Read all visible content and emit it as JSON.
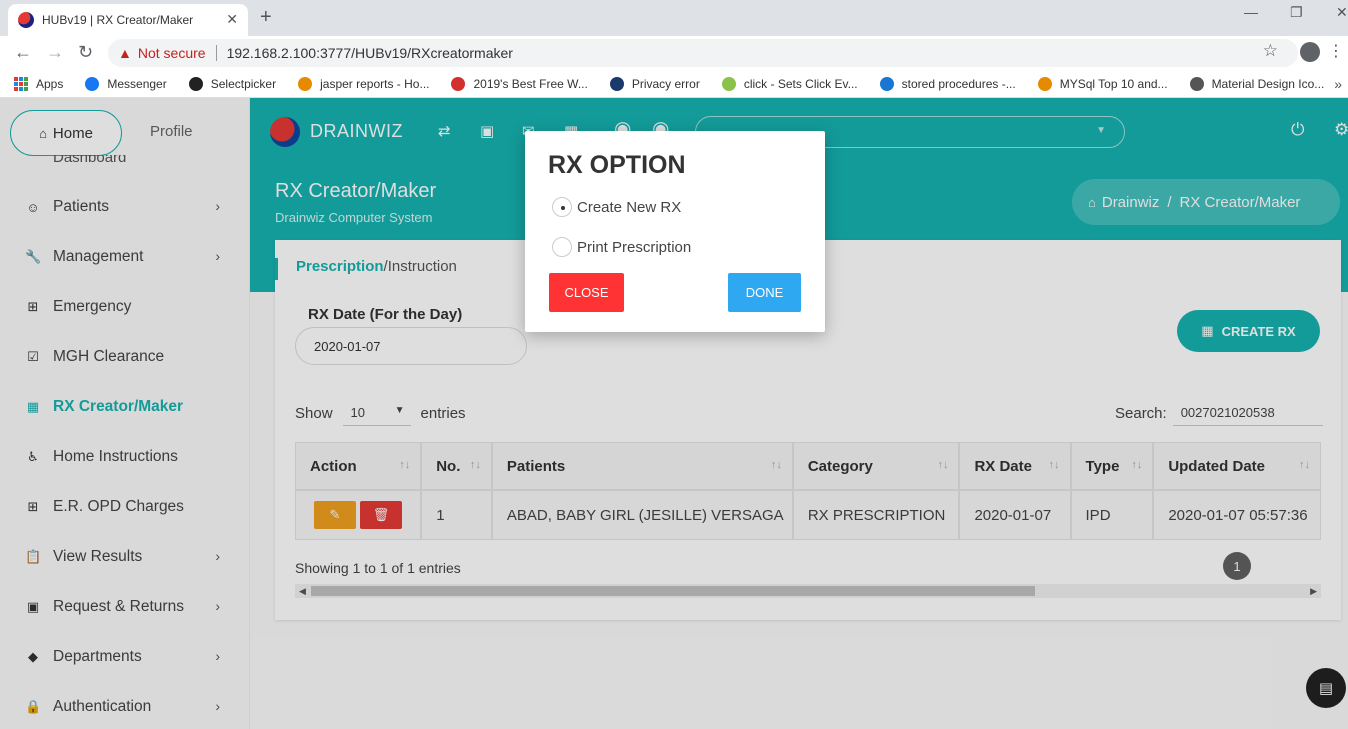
{
  "browser": {
    "tab_title": "HUBv19 | RX Creator/Maker",
    "tab_close": "✕",
    "new_tab": "+",
    "not_secure": "Not secure",
    "url": "192.168.2.100:3777/HUBv19/RXcreatormaker",
    "bookmarks": [
      "Apps",
      "Messenger",
      "Selectpicker",
      "jasper reports - Ho...",
      "2019's Best Free W...",
      "Privacy error",
      "click - Sets Click Ev...",
      "stored procedures -...",
      "MYSql Top 10 and...",
      "Material Design Ico..."
    ],
    "bookmarks_more": "»"
  },
  "sidebar": {
    "home": "Home",
    "profile": "Profile",
    "ghost": "Dashboard",
    "items": [
      {
        "label": "Patients",
        "icon": "smile-icon",
        "glyph": "☺",
        "chevron": "›"
      },
      {
        "label": "Management",
        "icon": "wrench-icon",
        "glyph": "🔧",
        "chevron": "›"
      },
      {
        "label": "Emergency",
        "icon": "plus-square-icon",
        "glyph": "⊞",
        "chevron": ""
      },
      {
        "label": "MGH Clearance",
        "icon": "check-square-icon",
        "glyph": "☑",
        "chevron": ""
      },
      {
        "label": "RX Creator/Maker",
        "icon": "grid-icon",
        "glyph": "▦",
        "chevron": ""
      },
      {
        "label": "Home Instructions",
        "icon": "wheelchair-icon",
        "glyph": "♿",
        "chevron": ""
      },
      {
        "label": "E.R. OPD Charges",
        "icon": "hospital-icon",
        "glyph": "⊞",
        "chevron": ""
      },
      {
        "label": "View Results",
        "icon": "clipboard-icon",
        "glyph": "📋",
        "chevron": "›"
      },
      {
        "label": "Request & Returns",
        "icon": "receipt-icon",
        "glyph": "▣",
        "chevron": "›"
      },
      {
        "label": "Departments",
        "icon": "tag-icon",
        "glyph": "◆",
        "chevron": "›"
      },
      {
        "label": "Authentication",
        "icon": "lock-icon",
        "glyph": "🔒",
        "chevron": "›"
      }
    ]
  },
  "topbar": {
    "brand": "DRAINWIZ"
  },
  "header": {
    "title": "RX Creator/Maker",
    "subtitle": "Drainwiz Computer System",
    "crumb_home": "Drainwiz",
    "crumb_sep": "/",
    "crumb_current": "RX Creator/Maker"
  },
  "card": {
    "tab_prescription": "Prescription",
    "tab_instruction": "/Instruction",
    "rx_date_label": "RX Date (For the Day)",
    "rx_date_value": "2020-01-07",
    "create_rx": "CREATE RX",
    "show_label": "Show",
    "show_value": "10",
    "entries_label": "entries",
    "search_label": "Search:",
    "search_value": "0027021020538",
    "columns": [
      "Action",
      "No.",
      "Patients",
      "Category",
      "RX Date",
      "Type",
      "Updated Date"
    ],
    "rows": [
      {
        "no": "1",
        "patient": "ABAD, BABY GIRL (JESILLE) VERSAGA",
        "category": "RX PRESCRIPTION",
        "rx_date": "2020-01-07",
        "type": "IPD",
        "updated": "2020-01-07 05:57:36"
      }
    ],
    "showing": "Showing 1 to 1 of 1 entries",
    "page": "1"
  },
  "modal": {
    "title": "RX OPTION",
    "option_new": "Create New RX",
    "option_print": "Print Prescription",
    "close": "CLOSE",
    "done": "DONE"
  },
  "colors": {
    "accent": "#16b3b0",
    "danger": "#ff3333",
    "primary": "#2fa8f2",
    "warning": "#f0a020"
  }
}
